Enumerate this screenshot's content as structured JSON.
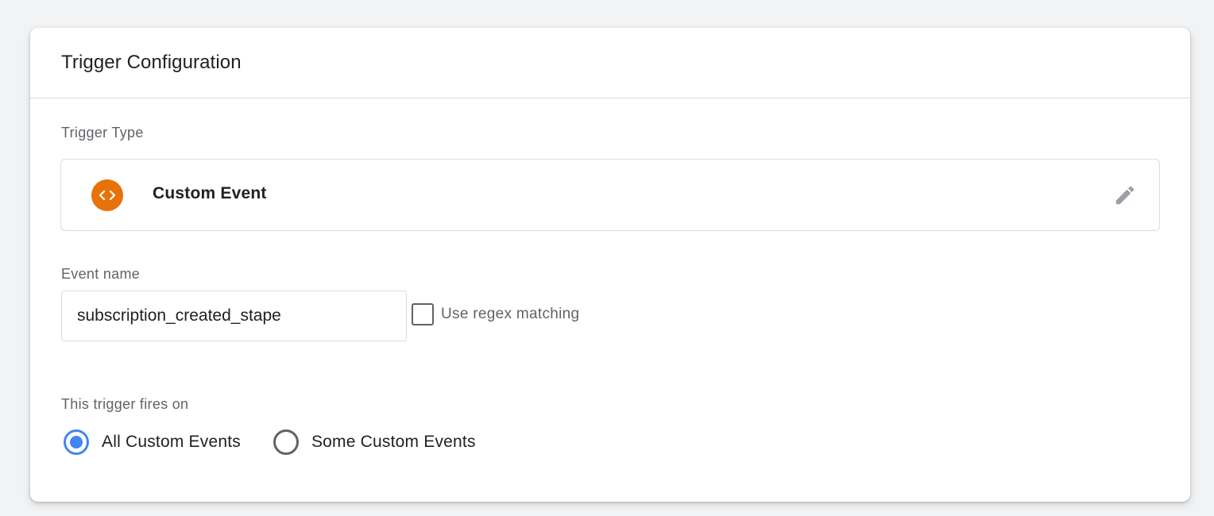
{
  "card": {
    "title": "Trigger Configuration"
  },
  "trigger_type": {
    "label": "Trigger Type",
    "name": "Custom Event",
    "icon": "custom-event-code-icon",
    "icon_color": "#e8710a"
  },
  "event_name": {
    "label": "Event name",
    "value": "subscription_created_stape",
    "regex_label": "Use regex matching",
    "regex_checked": false
  },
  "fires_on": {
    "label": "This trigger fires on",
    "options": [
      {
        "label": "All Custom Events",
        "selected": true
      },
      {
        "label": "Some Custom Events",
        "selected": false
      }
    ],
    "accent_color": "#4285f4"
  }
}
